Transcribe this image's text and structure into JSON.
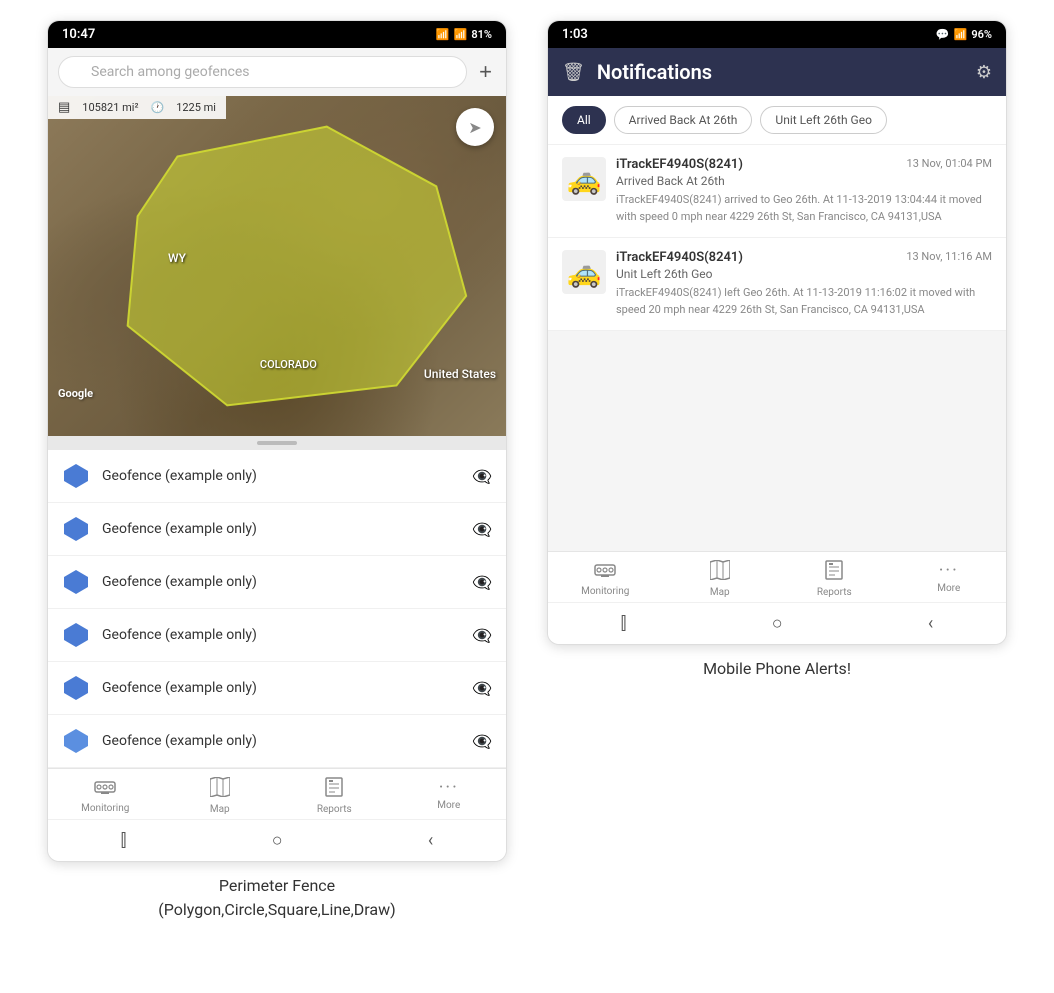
{
  "left_phone": {
    "status_bar": {
      "time": "10:47",
      "wifi": "WiFi",
      "signal": "81%",
      "battery": "81%"
    },
    "search": {
      "placeholder": "Search among geofences"
    },
    "map": {
      "stats": "105821 mi²",
      "distance": "1225 mi",
      "state_label": "WY",
      "country_label": "United States",
      "state_label2": "COLORADO",
      "google": "Google"
    },
    "geofence_items": [
      {
        "label": "Geofence (example only)"
      },
      {
        "label": "Geofence (example only)"
      },
      {
        "label": "Geofence (example only)"
      },
      {
        "label": "Geofence (example only)"
      },
      {
        "label": "Geofence (example only)"
      },
      {
        "label": "Geofence (example only)"
      }
    ],
    "nav": {
      "items": [
        {
          "label": "Monitoring",
          "icon": "🚌"
        },
        {
          "label": "Map",
          "icon": "🗺"
        },
        {
          "label": "Reports",
          "icon": "📊"
        },
        {
          "label": "More",
          "icon": "···"
        }
      ]
    },
    "caption": "Perimeter Fence\n(Polygon,Circle,Square,Line,Draw)"
  },
  "right_phone": {
    "status_bar": {
      "time": "1:03",
      "battery": "96%"
    },
    "header": {
      "title": "Notifications",
      "delete_icon": "🗑",
      "settings_icon": "⚙"
    },
    "filter_tabs": [
      {
        "label": "All",
        "active": true
      },
      {
        "label": "Arrived Back At 26th",
        "active": false
      },
      {
        "label": "Unit Left 26th Geo",
        "active": false
      }
    ],
    "notifications": [
      {
        "device": "iTrackEF4940S(8241)",
        "time": "13 Nov, 01:04 PM",
        "event": "Arrived Back At 26th",
        "detail": "iTrackEF4940S(8241) arrived to Geo 26th.   At 11-13-2019 13:04:44 it moved with speed 0 mph near 4229 26th St, San Francisco, CA 94131,USA"
      },
      {
        "device": "iTrackEF4940S(8241)",
        "time": "13 Nov, 11:16 AM",
        "event": "Unit Left 26th Geo",
        "detail": "iTrackEF4940S(8241) left Geo 26th.   At 11-13-2019 11:16:02 it moved with speed 20 mph near 4229 26th St, San Francisco, CA 94131,USA"
      }
    ],
    "nav": {
      "items": [
        {
          "label": "Monitoring",
          "icon": "🚌"
        },
        {
          "label": "Map",
          "icon": "🗺"
        },
        {
          "label": "Reports",
          "icon": "📊"
        },
        {
          "label": "More",
          "icon": "···"
        }
      ]
    },
    "caption": "Mobile Phone Alerts!"
  }
}
